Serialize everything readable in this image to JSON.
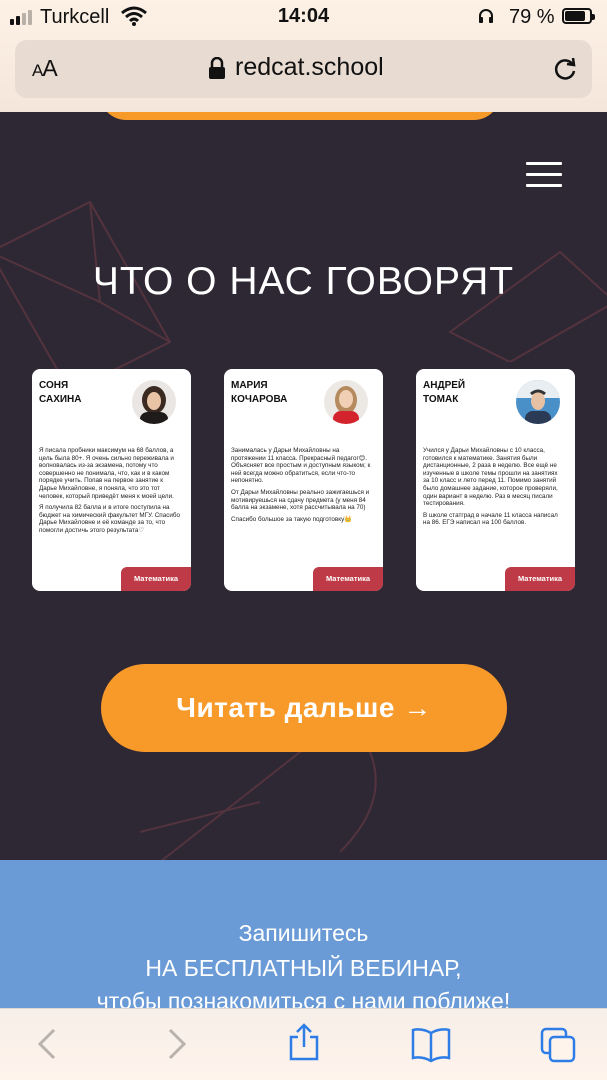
{
  "status_bar": {
    "carrier": "Turkcell",
    "time": "14:04",
    "battery": "79 %"
  },
  "browser": {
    "text_size_label": "AA",
    "url": "redcat.school"
  },
  "section": {
    "heading": "ЧТО О НАС ГОВОРЯТ"
  },
  "reviews": [
    {
      "name_line1": "СОНЯ",
      "name_line2": "САХИНА",
      "paragraphs": [
        "Я писала пробники максимум на 68 баллов, а цель была 80+. Я очень сильно переживала и волновалась из-за экзамена, потому что совершенно не понимала, что, как и в каком порядке учить. Попав на первое занятие к Дарье Михайловне, я поняла, что это тот человек, который приведёт меня к моей цели.",
        "Я получила 82 балла и в итоге поступила на бюджет на химический факультет МГУ. Спасибо Дарье Михайловне и её команде за то, что помогли достичь этого результата♡"
      ],
      "subject": "Математика"
    },
    {
      "name_line1": "МАРИЯ",
      "name_line2": "КОЧАРОВА",
      "paragraphs": [
        "Занималась у Дарьи Михайловны на протяжении 11 класса. Прекрасный педагог😊. Объясняет все простым и доступным языком; к ней всегда можно обратиться, если что-то непонятно.",
        "От Дарьи Михайловны реально зажигаешься и мотивируешься на сдачу предмета (у меня 84 балла на экзамене, хотя рассчитывала на 70)",
        "Спасибо большое за такую подготовку👑"
      ],
      "subject": "Математика"
    },
    {
      "name_line1": "АНДРЕЙ",
      "name_line2": "ТОМАК",
      "paragraphs": [
        "Учился у Дарьи Михайловны с 10 класса, готовился к математике. Занятия были дистанционные, 2 раза в неделю. Все ещё не изученные в школе темы прошли на занятиях за 10 класс и лето перед 11. Помимо занятий было домашнее задание, которое проверяли, один вариант в неделю. Раз в месяц писали тестирования.",
        "В школе статград в начале 11 класса написал на 86. ЕГЭ написал на 100 баллов."
      ],
      "subject": "Математика"
    }
  ],
  "cta": {
    "read_more": "Читать дальше →"
  },
  "webinar": {
    "line1": "Запишитесь",
    "line2": "НА БЕСПЛАТНЫЙ ВЕБИНАР,",
    "line3": "чтобы познакомиться с нами поближе!"
  },
  "colors": {
    "page_bg": "#2e2834",
    "accent_orange": "#f79a2a",
    "tag_red": "#be3a46",
    "webinar_blue": "#6a9bd6"
  },
  "icons": {
    "toolbar": [
      "back-icon",
      "forward-icon",
      "share-icon",
      "bookmarks-icon",
      "tabs-icon"
    ]
  }
}
